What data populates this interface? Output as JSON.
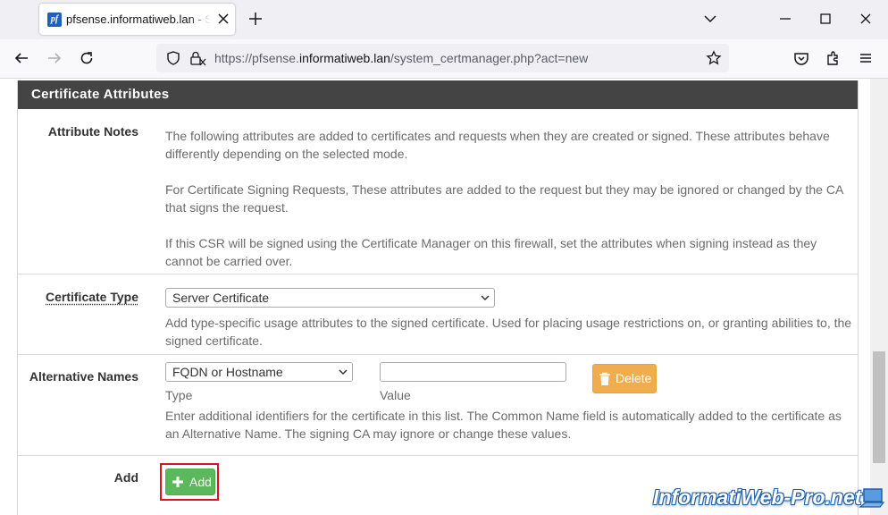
{
  "browser": {
    "tab_title": "pfsense.informatiweb.lan - System",
    "url_prefix": "https://pfsense.",
    "url_host": "informatiweb.lan",
    "url_path": "/system_certmanager.php?act=new"
  },
  "panel": {
    "title": "Certificate Attributes"
  },
  "attribute_notes": {
    "label": "Attribute Notes",
    "p1": "The following attributes are added to certificates and requests when they are created or signed. These attributes behave differently depending on the selected mode.",
    "p2": "For Certificate Signing Requests, These attributes are added to the request but they may be ignored or changed by the CA that signs the request.",
    "p3": "If this CSR will be signed using the Certificate Manager on this firewall, set the attributes when signing instead as they cannot be carried over."
  },
  "certificate_type": {
    "label": "Certificate Type",
    "selected": "Server Certificate",
    "help": "Add type-specific usage attributes to the signed certificate. Used for placing usage restrictions on, or granting abilities to, the signed certificate."
  },
  "alternative_names": {
    "label": "Alternative Names",
    "type_selected": "FQDN or Hostname",
    "value": "",
    "type_caption": "Type",
    "value_caption": "Value",
    "delete_label": "Delete",
    "help": "Enter additional identifiers for the certificate in this list. The Common Name field is automatically added to the certificate as an Alternative Name. The signing CA may ignore or change these values."
  },
  "add_row": {
    "label": "Add",
    "button_label": "Add"
  },
  "watermark": "InformatiWeb-Pro.net",
  "colors": {
    "panel_header": "#444444",
    "add_button": "#5cb85c",
    "delete_button": "#f0ad4e",
    "highlight": "#d9141e"
  }
}
